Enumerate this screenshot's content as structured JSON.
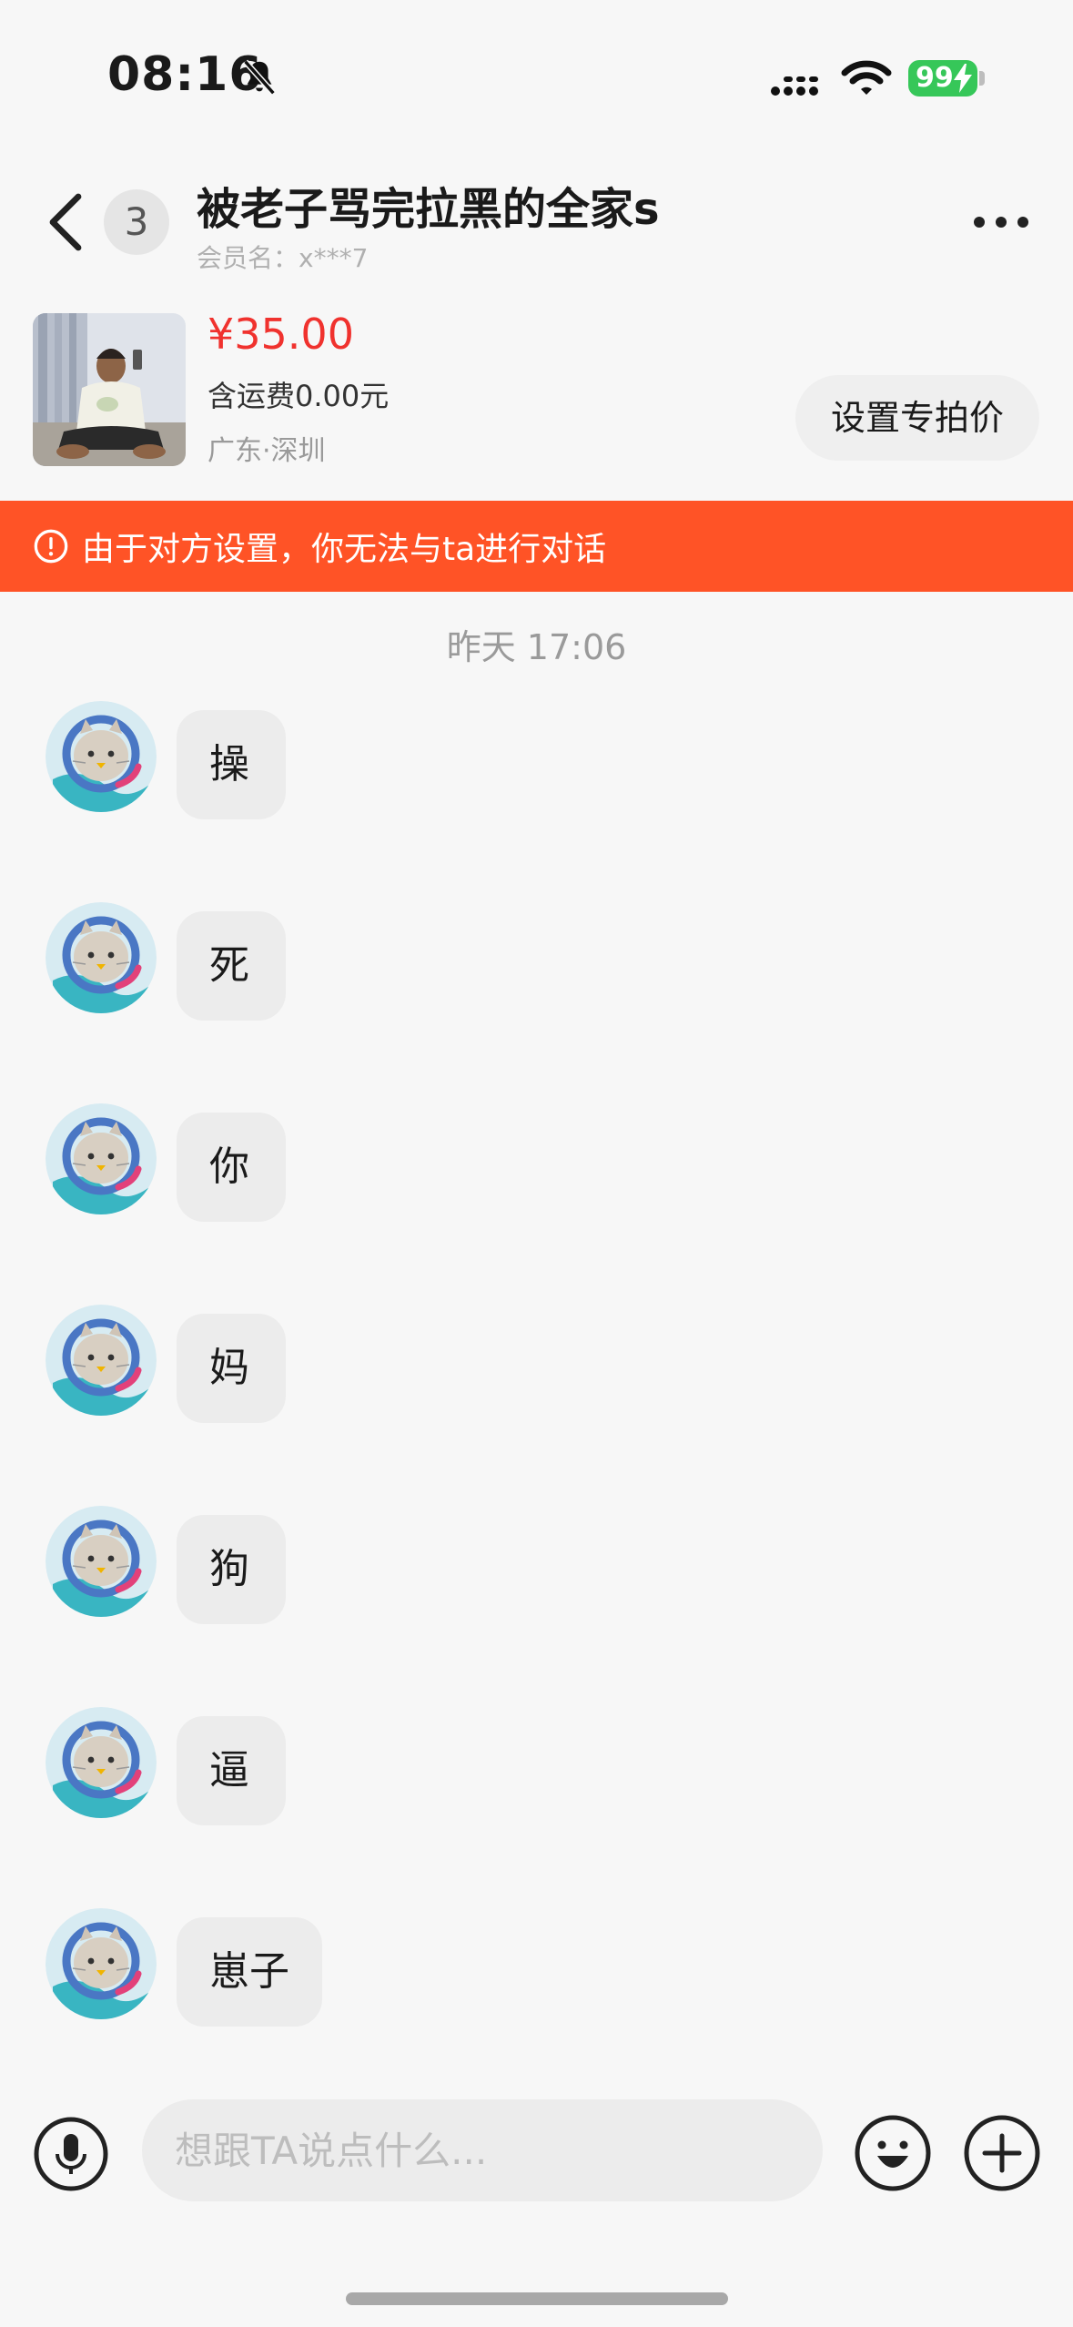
{
  "status_bar": {
    "time": "08:16",
    "battery": "99",
    "icons": [
      "bell-slash-icon",
      "signal-icon",
      "wifi-icon",
      "battery-charging-icon"
    ]
  },
  "header": {
    "unread_count": "3",
    "title": "被老子骂完拉黑的全家s",
    "member_name": "会员名：x***7",
    "icons": [
      "back-icon",
      "more-icon"
    ]
  },
  "product": {
    "price": "¥35.00",
    "shipping": "含运费0.00元",
    "location": "广东·深圳",
    "special_price_button": "设置专拍价"
  },
  "warning": {
    "text": "由于对方设置，你无法与ta进行对话",
    "icon": "alert-circle-icon"
  },
  "timestamp": "昨天 17:06",
  "messages": [
    {
      "text": "操"
    },
    {
      "text": "死"
    },
    {
      "text": "你"
    },
    {
      "text": "妈"
    },
    {
      "text": "狗"
    },
    {
      "text": "逼"
    },
    {
      "text": "崽子"
    }
  ],
  "input_bar": {
    "placeholder": "想跟TA说点什么...",
    "icons": [
      "microphone-icon",
      "emoji-icon",
      "plus-icon"
    ]
  },
  "colors": {
    "accent": "#ff5326",
    "price": "#f0322e",
    "battery": "#36c759"
  }
}
